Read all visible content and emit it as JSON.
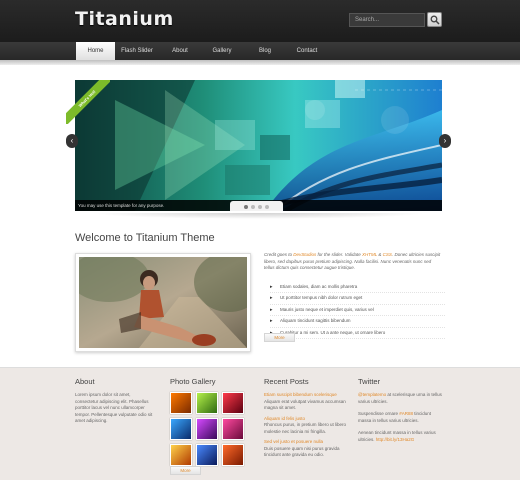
{
  "header": {
    "logo": "Titanium",
    "search_placeholder": "Search..."
  },
  "nav": {
    "items": [
      {
        "label": "Home",
        "active": true
      },
      {
        "label": "Flash Slider",
        "active": false
      },
      {
        "label": "About",
        "active": false
      },
      {
        "label": "Gallery",
        "active": false
      },
      {
        "label": "Blog",
        "active": false
      },
      {
        "label": "Contact",
        "active": false
      }
    ]
  },
  "slider": {
    "ribbon": "What's Hot!",
    "caption": "You may use this template for any purpose.",
    "prev_icon": "chevron-left-icon",
    "next_icon": "chevron-right-icon",
    "slide_count": 4,
    "active_slide": 1
  },
  "welcome": {
    "title": "Welcome to Titanium Theme",
    "intro_prefix": "Credit goes to ",
    "intro_link": "DevStudios",
    "intro_mid": " for the slider. Validate ",
    "intro_xhtml": "XHTML",
    "intro_and": " & ",
    "intro_css": "CSS",
    "intro_rest": ". Donec ultricies suscipit libero, sed dapibus purus pretium adipiscing. Nulla facilisi. Nunc venenatis nunc sed tellus dictum quis consectetur augue tristique.",
    "bullets": [
      "Etiam sodales, diam ac mollis pharetra",
      "Ut porttitor tempus nibh dolor rutrum eget",
      "Mauris justo neque et imperdiet quis, varius vel",
      "Aliquam tincidunt sagittis bibendum",
      "Curabitur a mi sem. Ut a ante neque, ut ornare libero"
    ],
    "more_label": "More"
  },
  "footer": {
    "about": {
      "title": "About",
      "text": "Lorem ipsum dolor sit amet, consectetur adipiscing elit. Phasellus porttitor lacus vel nunc ullamcorper tempor. Pellentesque vulputate odio sit amet adipiscing."
    },
    "gallery": {
      "title": "Photo Gallery",
      "more_label": "More"
    },
    "posts": {
      "title": "Recent Posts",
      "items": [
        {
          "link": "Etiam suscipit bibendum scelerisque",
          "text": "Aliquam erat volutpat vivamus accumsan magna sit amet."
        },
        {
          "link": "Aliquam id felis justo",
          "text": "Rhoncus purus, in pretium libero ut libero molestie nec lacinia mi fringilla."
        },
        {
          "link": "Sed vel justo et posuere nulla",
          "text": "Duis posuere quam nisi purus gravida tincidunt ante gravida eu odio."
        }
      ]
    },
    "twitter": {
      "title": "Twitter",
      "items": [
        {
          "handle": "@templatemo",
          "text": " at scelerisque urna in tellus varius ultricies."
        },
        {
          "prefix": "Suspendisse ornare ",
          "link": "#AR88",
          "text": " tincidunt massa in tellus varius ultricies."
        },
        {
          "prefix": "Aenean tincidunt massa in tellus varius ultricies. ",
          "link": "http://bit.ly/13Ha2G"
        }
      ]
    }
  },
  "colors": {
    "accent": "#e0892a",
    "ribbon": "#7dbb2a",
    "header": "#222222",
    "footer_bg": "#ede8e5"
  }
}
